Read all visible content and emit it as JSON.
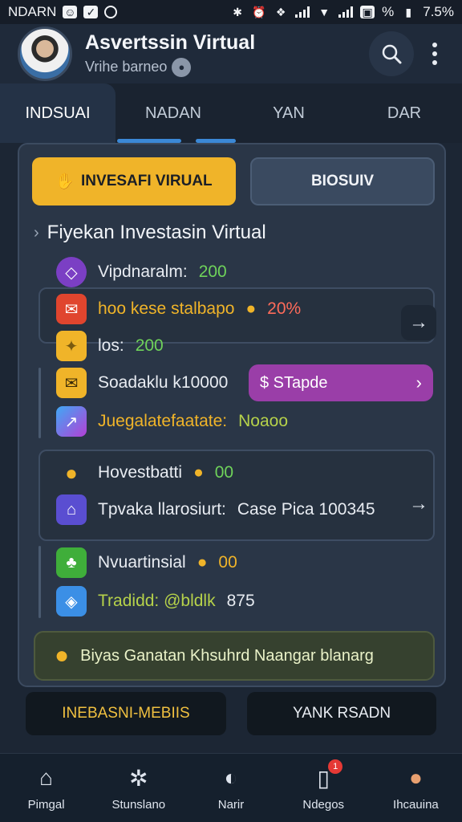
{
  "status": {
    "carrier": "NDARN",
    "battery_percent": "%",
    "battery_level": "7.5%"
  },
  "app": {
    "title": "Asvertssin Virtual",
    "subtitle": "Vrihe barneo"
  },
  "tabs": [
    {
      "label": "INDSUAI"
    },
    {
      "label": "NADAN"
    },
    {
      "label": "YAN"
    },
    {
      "label": "DAR"
    }
  ],
  "card": {
    "primary_button": "INVESAFI VIRUAL",
    "secondary_button": "BIOSUIV",
    "heading": "Fiyekan Investasin Virtual",
    "rows": [
      {
        "label": "Vipdnaralm:",
        "value": "200"
      },
      {
        "label": "hoo kese stalbapo",
        "value": "20%"
      },
      {
        "label": "los:",
        "value": "200"
      },
      {
        "label": "Soadaklu k10000",
        "pill": "$ STapde"
      },
      {
        "label": "Juegalatefaatate:",
        "value": "Noaoo"
      },
      {
        "label": "Hovestbatti",
        "value": "00"
      },
      {
        "label": "Tpvaka llarosiurt:",
        "value": "Case Pica 100345"
      },
      {
        "label": "Nvuartinsial",
        "value": "00"
      },
      {
        "label": "Tradidd: @bldlk",
        "value": "875"
      }
    ],
    "banner": "Biyas Ganatan Khsuhrd Naangar blanarg"
  },
  "bottom_buttons": {
    "left": "INEBASNI-MEBIIS",
    "right": "YANK RSADN"
  },
  "nav": [
    {
      "label": "Pimgal",
      "icon": "home-icon"
    },
    {
      "label": "Stunslano",
      "icon": "gear-icon"
    },
    {
      "label": "Narir",
      "icon": "compass-icon"
    },
    {
      "label": "Ndegos",
      "icon": "document-icon",
      "badge": "1"
    },
    {
      "label": "Ihcauina",
      "icon": "person-icon"
    }
  ],
  "colors": {
    "accent": "#f0b429",
    "tab_indicator": "#3b88d6",
    "pill": "#9a3ea8",
    "positive": "#6fd35a",
    "negative": "#ff6b5a"
  }
}
